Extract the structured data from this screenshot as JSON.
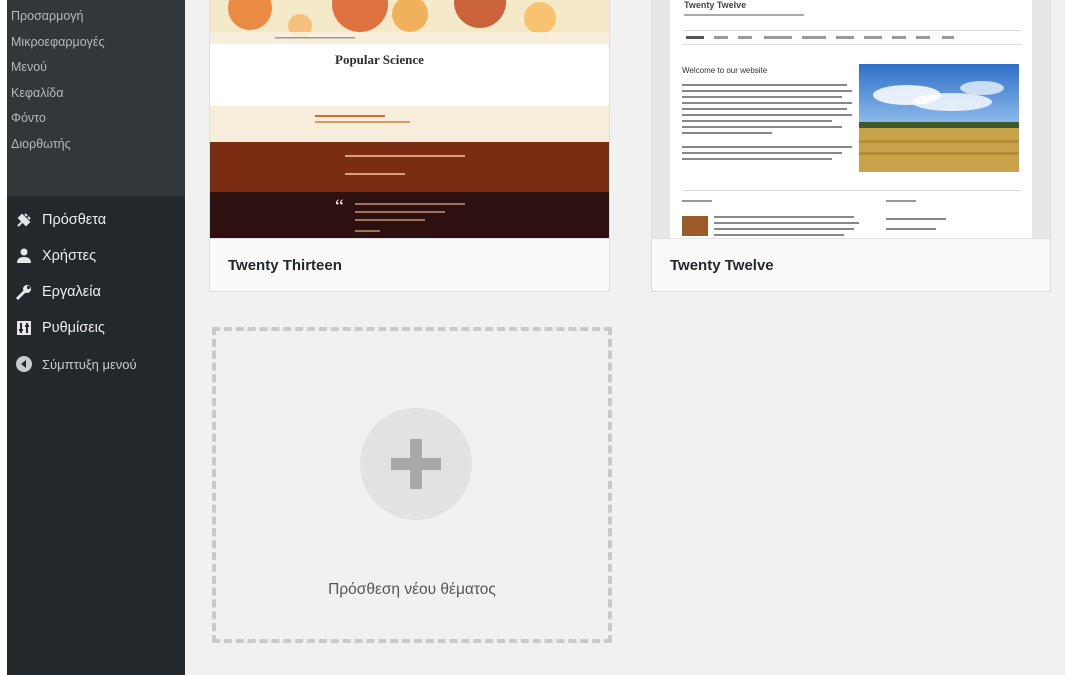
{
  "sidebar": {
    "submenu": [
      "Προσαρμογή",
      "Μικροεφαρμογές",
      "Μενού",
      "Κεφαλίδα",
      "Φόντο",
      "Διορθωτής"
    ],
    "menu": [
      {
        "label": "Πρόσθετα",
        "icon": "plugin-icon"
      },
      {
        "label": "Χρήστες",
        "icon": "users-icon"
      },
      {
        "label": "Εργαλεία",
        "icon": "tools-icon"
      },
      {
        "label": "Ρυθμίσεις",
        "icon": "settings-icon"
      },
      {
        "label": "Σύμπτυξη μενού",
        "icon": "collapse-icon"
      }
    ]
  },
  "themes": [
    {
      "name": "Twenty Thirteen",
      "preview": {
        "title": "Popular Science",
        "quote_mark": "“"
      }
    },
    {
      "name": "Twenty Twelve",
      "preview": {
        "site_title": "Twenty Twelve",
        "heading": "Welcome to our website"
      }
    }
  ],
  "add_new": {
    "label": "Πρόσθεση νέου θέματος"
  },
  "colors": {
    "sidebar": "#23282d",
    "submenu": "#32373c",
    "page": "#f1f1f1",
    "accent": "#bc360a"
  }
}
